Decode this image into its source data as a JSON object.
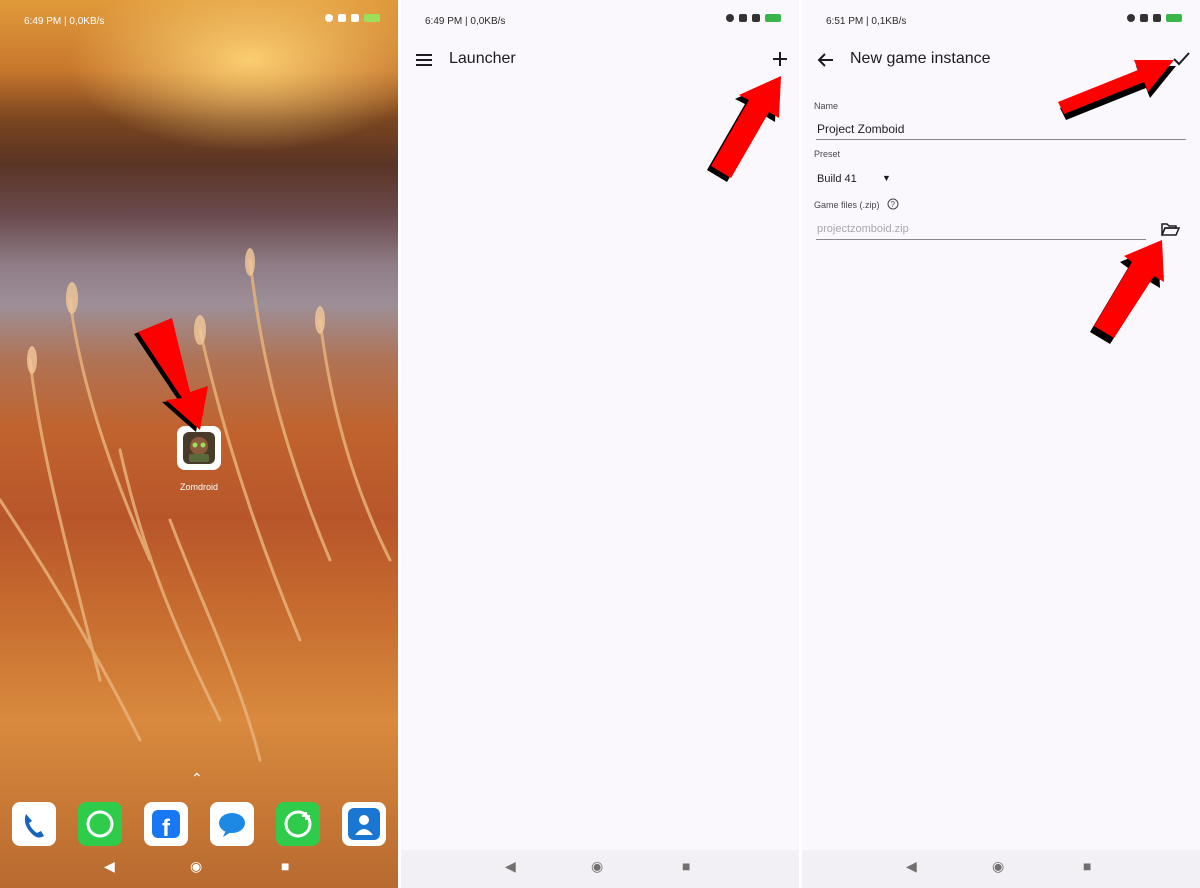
{
  "screen1": {
    "status": {
      "time": "6:49 PM | 0,0KB/s"
    },
    "app_label": "Zomdroid",
    "dock": [
      "phone-icon",
      "whatsapp-icon",
      "facebook-icon",
      "messages-icon",
      "whatsapp-business-icon",
      "contacts-icon"
    ]
  },
  "screen2": {
    "status": {
      "time": "6:49 PM | 0,0KB/s"
    },
    "title": "Launcher"
  },
  "screen3": {
    "status": {
      "time": "6:51 PM | 0,1KB/s"
    },
    "title": "New game instance",
    "name_label": "Name",
    "name_value": "Project Zomboid",
    "preset_label": "Preset",
    "preset_value": "Build 41",
    "files_label": "Game files (.zip)",
    "files_placeholder": "projectzomboid.zip"
  },
  "colors": {
    "arrow": "#ff0000",
    "accent": "#1d1b20"
  }
}
